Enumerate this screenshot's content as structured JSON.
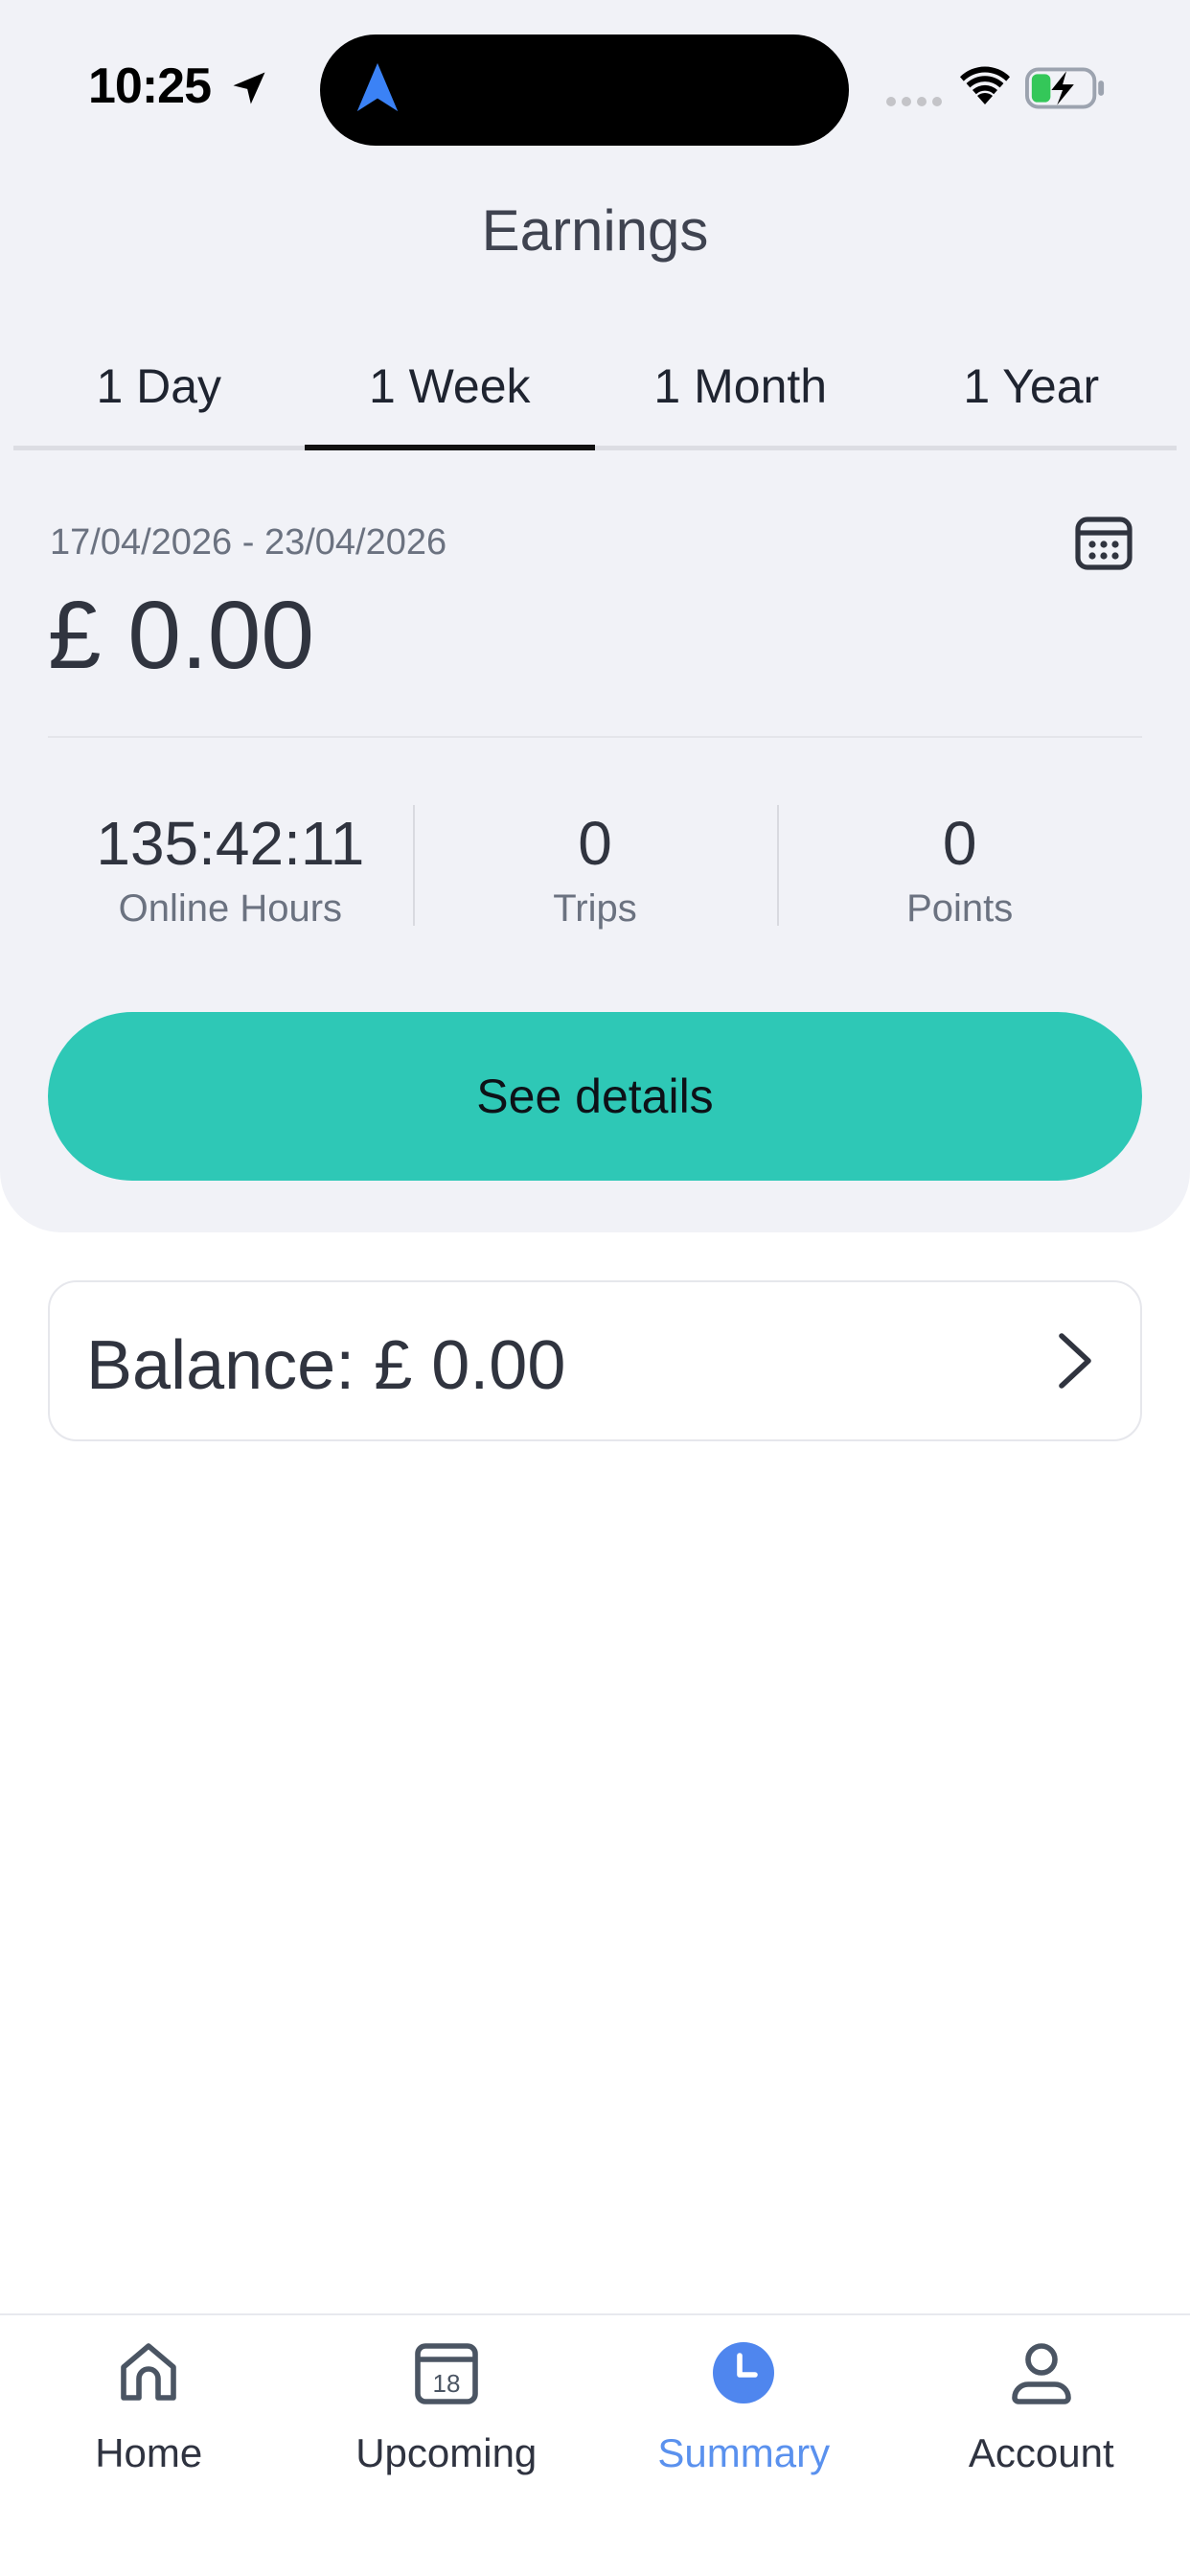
{
  "status_bar": {
    "time": "10:25"
  },
  "header": {
    "title": "Earnings"
  },
  "tabs": [
    {
      "label": "1 Day",
      "active": false
    },
    {
      "label": "1 Week",
      "active": true
    },
    {
      "label": "1 Month",
      "active": false
    },
    {
      "label": "1 Year",
      "active": false
    }
  ],
  "summary": {
    "date_range": "17/04/2026 - 23/04/2026",
    "amount": "£ 0.00"
  },
  "stats": [
    {
      "value": "135:42:11",
      "label": "Online Hours"
    },
    {
      "value": "0",
      "label": "Trips"
    },
    {
      "value": "0",
      "label": "Points"
    }
  ],
  "actions": {
    "see_details_label": "See details"
  },
  "balance": {
    "text": "Balance: £ 0.00"
  },
  "bottom_nav": [
    {
      "label": "Home",
      "icon": "home-icon",
      "active": false
    },
    {
      "label": "Upcoming",
      "icon": "calendar-icon",
      "active": false,
      "icon_text": "18"
    },
    {
      "label": "Summary",
      "icon": "clock-icon",
      "active": true
    },
    {
      "label": "Account",
      "icon": "user-icon",
      "active": false
    }
  ],
  "colors": {
    "accent": "#2ec8b6",
    "active_nav": "#4f86ee",
    "panel_bg": "#f1f2f7"
  }
}
